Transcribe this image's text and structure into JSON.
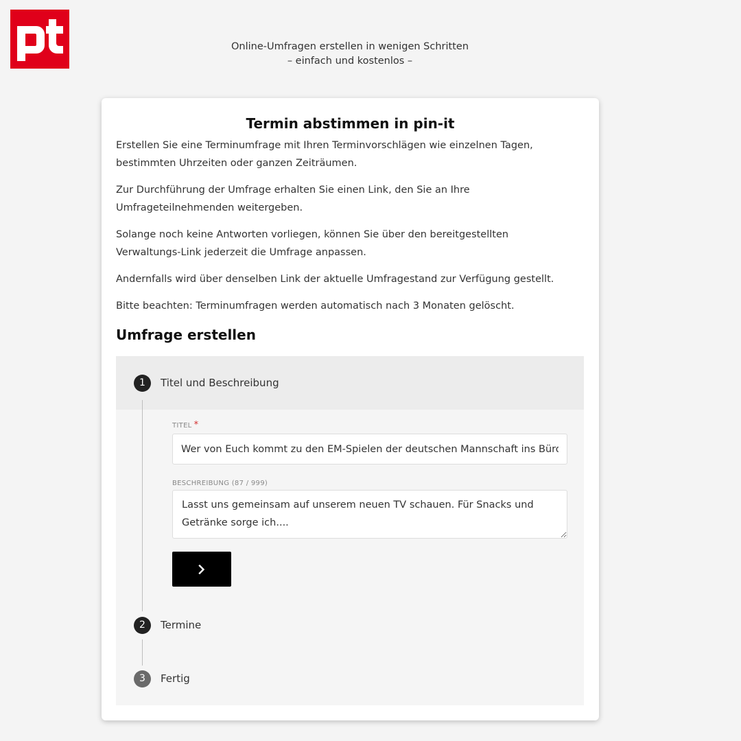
{
  "brand": {
    "logo_icon": "pin-it-logo-icon",
    "logo_color": "#e0001a"
  },
  "header": {
    "tagline_line1": "Online-Umfragen erstellen in wenigen Schritten",
    "tagline_line2": "– einfach und kostenlos –"
  },
  "intro": {
    "title": "Termin abstimmen in pin-it",
    "paragraphs": [
      "Erstellen Sie eine Terminumfrage mit Ihren Terminvorschlägen wie einzelnen Tagen, bestimmten Uhrzeiten oder ganzen Zeiträumen.",
      "Zur Durchführung der Umfrage erhalten Sie einen Link, den Sie an Ihre Umfrageteilnehmenden weitergeben.",
      "Solange noch keine Antworten vorliegen, können Sie über den bereitgestellten Verwaltungs-Link jederzeit die Umfrage anpassen.",
      "Andernfalls wird über denselben Link der aktuelle Umfragestand zur Verfügung gestellt.",
      "Bitte beachten: Terminumfragen werden automatisch nach 3 Monaten gelöscht."
    ]
  },
  "survey": {
    "section_title": "Umfrage erstellen",
    "steps": [
      {
        "number": "1",
        "label": "Titel und Beschreibung"
      },
      {
        "number": "2",
        "label": "Termine"
      },
      {
        "number": "3",
        "label": "Fertig"
      }
    ],
    "form": {
      "title_label": "TITEL",
      "title_required": "*",
      "title_value": "Wer von Euch kommt zu den EM-Spielen der deutschen Mannschaft ins Büro?",
      "description_label": "BESCHREIBUNG (87 / 999)",
      "description_value": "Lasst uns gemeinsam auf unserem neuen TV schauen. Für Snacks und Getränke sorge ich....",
      "next_icon": "chevron-right-icon"
    }
  }
}
